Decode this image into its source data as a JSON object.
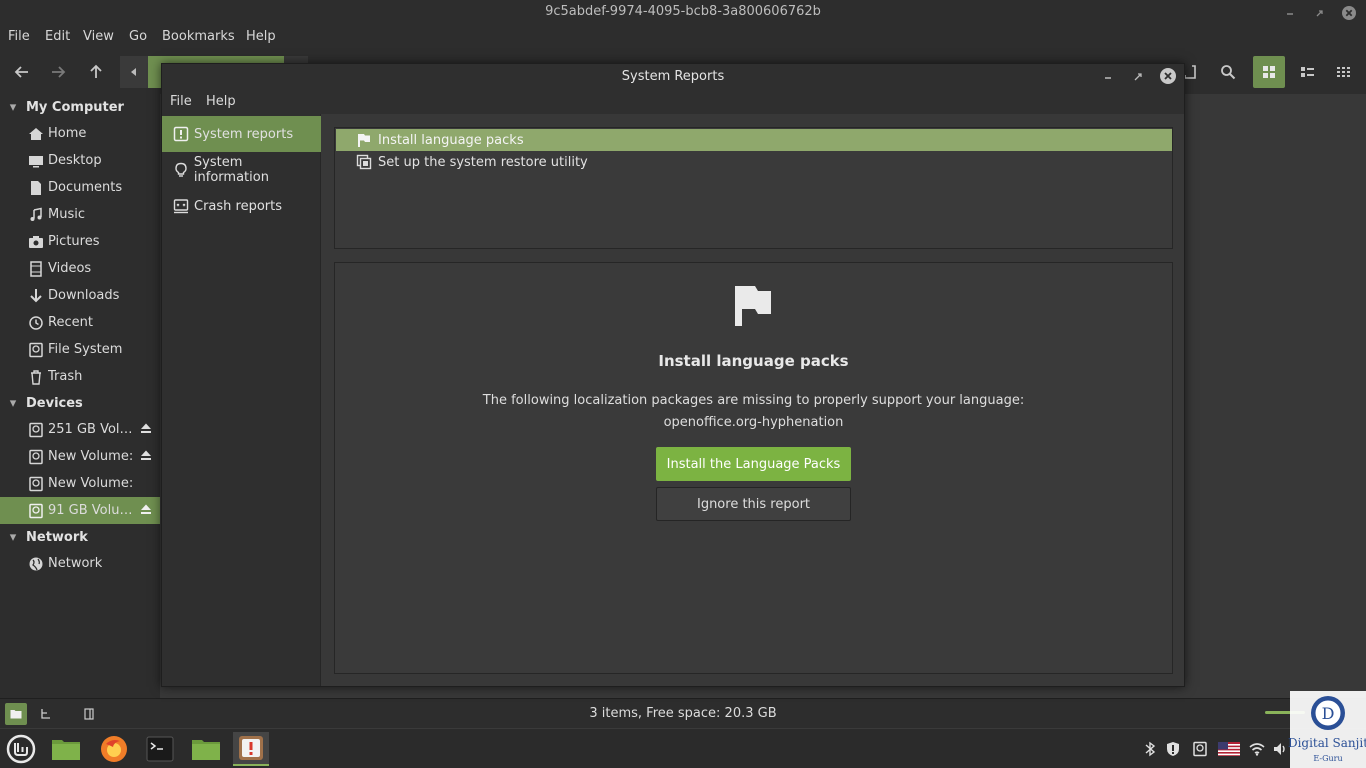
{
  "file_manager": {
    "window_title": "9c5abdef-9974-4095-bcb8-3a800606762b",
    "menu": [
      "File",
      "Edit",
      "View",
      "Go",
      "Bookmarks",
      "Help"
    ],
    "sidebar": {
      "sections": [
        {
          "title": "My Computer",
          "items": [
            {
              "label": "Home",
              "icon": "home-icon"
            },
            {
              "label": "Desktop",
              "icon": "desktop-icon"
            },
            {
              "label": "Documents",
              "icon": "document-icon"
            },
            {
              "label": "Music",
              "icon": "music-icon"
            },
            {
              "label": "Pictures",
              "icon": "camera-icon"
            },
            {
              "label": "Videos",
              "icon": "film-icon"
            },
            {
              "label": "Downloads",
              "icon": "download-icon"
            },
            {
              "label": "Recent",
              "icon": "clock-icon"
            },
            {
              "label": "File System",
              "icon": "drive-icon"
            },
            {
              "label": "Trash",
              "icon": "trash-icon"
            }
          ]
        },
        {
          "title": "Devices",
          "items": [
            {
              "label": "251 GB Vol…",
              "icon": "drive-icon",
              "eject": true
            },
            {
              "label": "New Volume:",
              "icon": "drive-icon",
              "eject": true
            },
            {
              "label": "New Volume:",
              "icon": "drive-icon",
              "eject": false
            },
            {
              "label": "91 GB Volu…",
              "icon": "drive-icon",
              "eject": true,
              "selected": true
            }
          ]
        },
        {
          "title": "Network",
          "items": [
            {
              "label": "Network",
              "icon": "network-icon"
            }
          ]
        }
      ]
    },
    "status_text": "3 items, Free space: 20.3 GB"
  },
  "dialog": {
    "title": "System Reports",
    "menu": [
      "File",
      "Help"
    ],
    "sidebar": [
      {
        "label": "System reports",
        "icon": "report-icon",
        "selected": true
      },
      {
        "label": "System information",
        "icon": "bulb-icon"
      },
      {
        "label": "Crash reports",
        "icon": "crash-icon"
      }
    ],
    "reports": [
      {
        "label": "Install language packs",
        "icon": "flag-icon",
        "selected": true
      },
      {
        "label": "Set up the system restore utility",
        "icon": "restore-icon"
      }
    ],
    "detail": {
      "title": "Install language packs",
      "description_line1": "The following localization packages are missing to properly support your language:",
      "description_line2": "openoffice.org-hyphenation",
      "primary_button": "Install the Language Packs",
      "secondary_button": "Ignore this report"
    }
  },
  "watermark": {
    "letter": "D",
    "text": "Digital Sanjit",
    "subtext": "E-Guru"
  },
  "colors": {
    "accent": "#6f8f50",
    "accent_bright": "#7cb342",
    "window_bg": "#383838"
  }
}
